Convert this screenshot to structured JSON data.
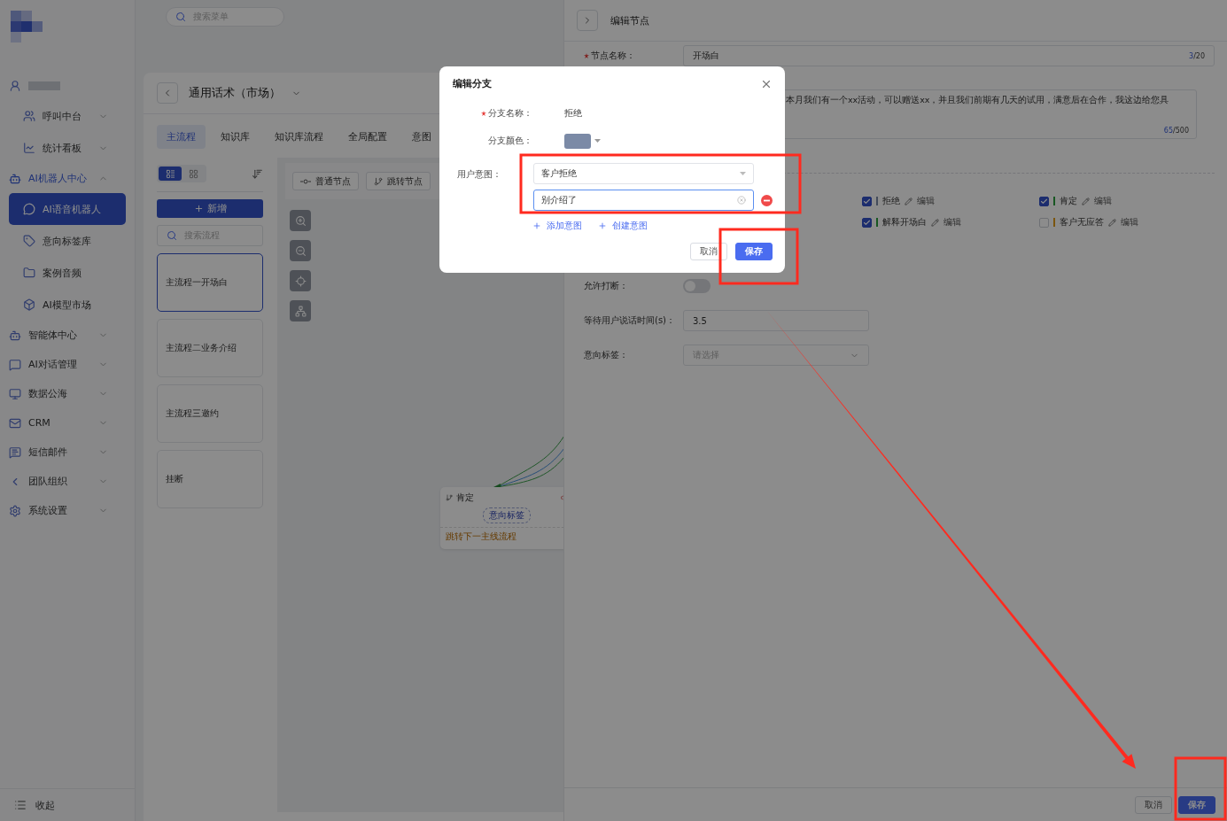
{
  "top_bar": {
    "search": {
      "placeholder": "搜索菜单"
    }
  },
  "sidebar": {
    "items": [
      {
        "kind": "account",
        "selected": false,
        "children": [
          {
            "kind": "group",
            "label": "呼叫中台",
            "expanded": false,
            "selected": false
          },
          {
            "kind": "group",
            "label": "统计看板",
            "expanded": false,
            "selected": false
          }
        ]
      },
      {
        "kind": "group",
        "label": "AI机器人中心",
        "expanded": true,
        "selected": false,
        "children": [
          {
            "kind": "link",
            "label": "AI语音机器人",
            "selected": true
          },
          {
            "kind": "link",
            "label": "意向标签库",
            "selected": false
          },
          {
            "kind": "link",
            "label": "案例音频",
            "selected": false
          },
          {
            "kind": "link",
            "label": "AI模型市场",
            "selected": false
          }
        ]
      },
      {
        "kind": "group",
        "label": "智能体中心",
        "expanded": false,
        "selected": false
      },
      {
        "kind": "group",
        "label": "AI对话管理",
        "expanded": false,
        "selected": false
      },
      {
        "kind": "group",
        "label": "数据公海",
        "expanded": false,
        "selected": false
      },
      {
        "kind": "group",
        "label": "CRM",
        "expanded": false,
        "selected": false
      },
      {
        "kind": "group",
        "label": "短信邮件",
        "expanded": false,
        "selected": false
      },
      {
        "kind": "group",
        "label": "团队组织",
        "expanded": false,
        "selected": false
      },
      {
        "kind": "group",
        "label": "系统设置",
        "expanded": false,
        "selected": false
      }
    ],
    "collapse_label": "收起"
  },
  "script_page": {
    "title": "通用话术（市场）",
    "tabs": [
      {
        "label": "主流程",
        "selected": true
      },
      {
        "label": "知识库",
        "selected": false
      },
      {
        "label": "知识库流程",
        "selected": false
      },
      {
        "label": "全局配置",
        "selected": false
      },
      {
        "label": "意图",
        "selected": false
      }
    ],
    "view_modes": [
      {
        "kind": "list",
        "selected": true
      },
      {
        "kind": "grid",
        "selected": false
      }
    ],
    "add_label": "新增",
    "search_placeholder": "搜索流程",
    "flows": [
      {
        "label": "主流程一开场白",
        "selected": true
      },
      {
        "label": "主流程二业务介绍",
        "selected": false
      },
      {
        "label": "主流程三邀约",
        "selected": false
      },
      {
        "label": "挂断",
        "selected": false
      }
    ],
    "canvas": {
      "node_buttons": [
        {
          "kind": "normal",
          "label": "普通节点"
        },
        {
          "kind": "jump",
          "label": "跳转节点"
        }
      ],
      "node": {
        "title": "肯定",
        "tag": "意向标签",
        "action": "跳转下一主线流程"
      }
    }
  },
  "drawer": {
    "title": "编辑节点",
    "node_name": {
      "label": "节点名称：",
      "required": true,
      "value": "开场白",
      "count": "3",
      "limit": "/20"
    },
    "script": {
      "value": "本月我们有一个xx活动，可以赠送xx，并且我们前期有几天的试用，满意后在合作，我这边给您具",
      "count": "65",
      "limit": "/500"
    },
    "branches": [
      {
        "label": "拒绝",
        "checked": true,
        "color": "#444c5b",
        "edit_label": "编辑"
      },
      {
        "label": "肯定",
        "checked": true,
        "color": "#195722",
        "edit_label": "编辑"
      },
      {
        "label": "解释开场白",
        "checked": true,
        "color": "#195722",
        "edit_label": "编辑"
      },
      {
        "label": "客户无应答",
        "checked": false,
        "color": "#7b550f",
        "edit_label": "编辑"
      }
    ],
    "interrupt": {
      "label": "允许打断：",
      "on": false
    },
    "wait_time": {
      "label": "等待用户说话时间(s)：",
      "value": "3.5"
    },
    "intent_tag": {
      "label": "意向标签：",
      "placeholder": "请选择"
    },
    "buttons": [
      {
        "kind": "secondary",
        "label": "取消"
      },
      {
        "kind": "primary",
        "label": "保存"
      }
    ]
  },
  "modal": {
    "title": "编辑分支",
    "branch_name": {
      "label": "分支名称：",
      "required": true,
      "value": "拒绝"
    },
    "branch_color": {
      "label": "分支颜色：",
      "color": "#7b8aa6"
    },
    "user_intent": {
      "label": "用户意图：",
      "select_value": "客户拒绝",
      "input_value": "别介绍了"
    },
    "links": [
      "添加意图",
      "创建意图"
    ],
    "buttons": [
      {
        "kind": "secondary",
        "label": "取消"
      },
      {
        "kind": "primary",
        "label": "保存"
      }
    ]
  },
  "annotations": [
    {
      "kind": "box"
    },
    {
      "kind": "box"
    },
    {
      "kind": "arrow"
    },
    {
      "kind": "box"
    }
  ]
}
